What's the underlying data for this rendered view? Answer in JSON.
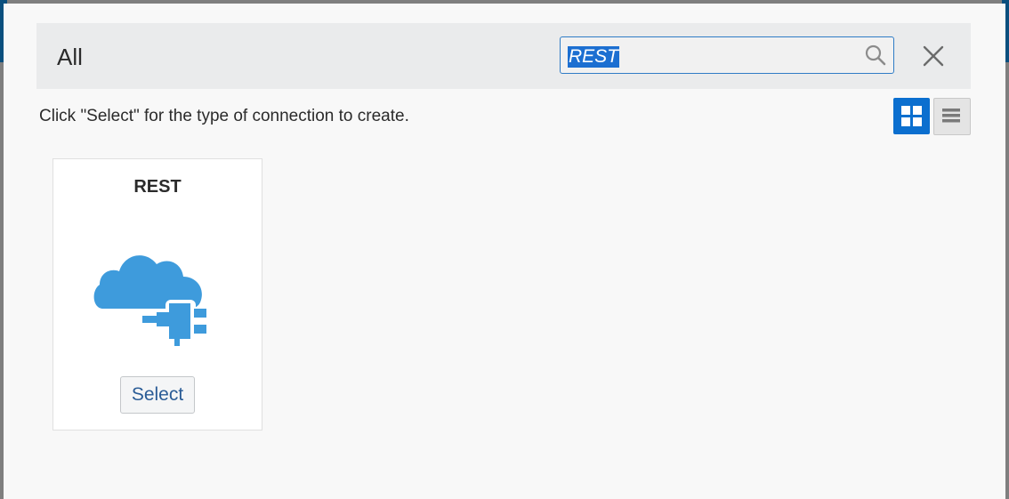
{
  "header": {
    "title": "All"
  },
  "search": {
    "value": "REST"
  },
  "instructions": "Click \"Select\" for the type of connection to create.",
  "view_toggle": {
    "active": "grid"
  },
  "cards": [
    {
      "title": "REST",
      "icon": "cloud-plug-icon",
      "button_label": "Select"
    }
  ],
  "colors": {
    "accent": "#0b6fcf",
    "icon_blue": "#3e9bdc",
    "selection": "#1c6fd1"
  }
}
